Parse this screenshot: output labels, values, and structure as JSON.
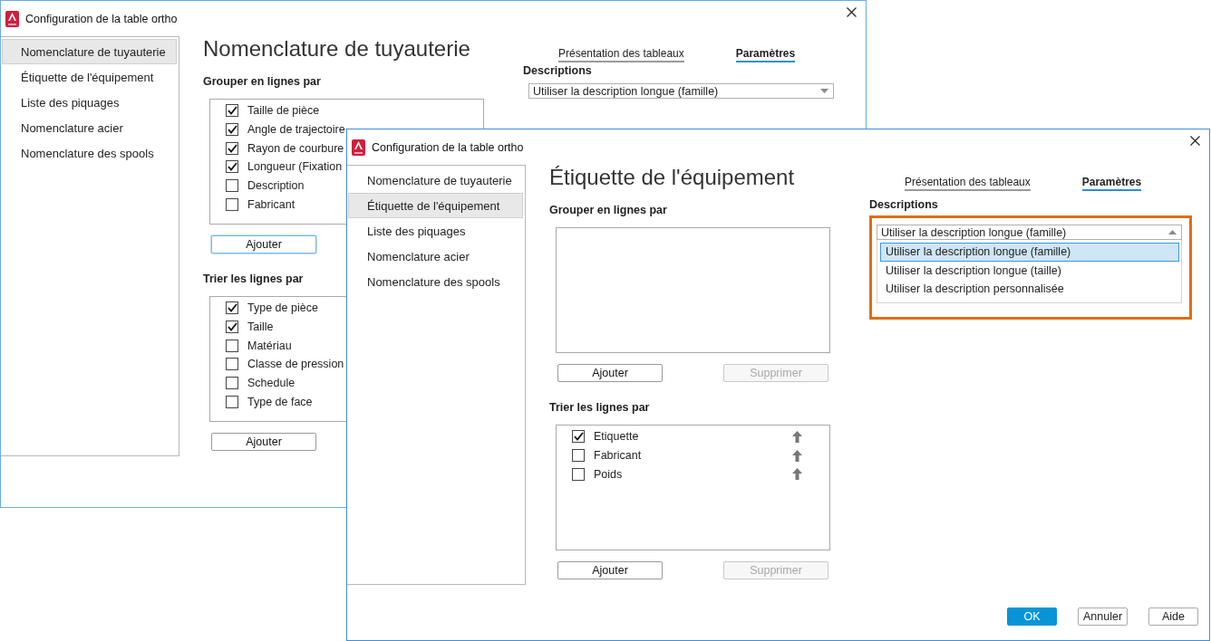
{
  "back_window": {
    "title": "Configuration de la table ortho",
    "sidebar": [
      {
        "label": "Nomenclature de tuyauterie",
        "selected": true
      },
      {
        "label": "Étiquette de l'équipement",
        "selected": false
      },
      {
        "label": "Liste des piquages",
        "selected": false
      },
      {
        "label": "Nomenclature acier",
        "selected": false
      },
      {
        "label": "Nomenclature des spools",
        "selected": false
      }
    ],
    "heading": "Nomenclature de tuyauterie",
    "tabs": [
      {
        "label": "Présentation des tableaux",
        "selected": false
      },
      {
        "label": "Paramètres",
        "selected": true
      }
    ],
    "group": {
      "label": "Grouper en lignes par",
      "items": [
        {
          "label": "Taille de pièce",
          "checked": true
        },
        {
          "label": "Angle de trajectoire",
          "checked": true
        },
        {
          "label": "Rayon de courbure",
          "checked": true
        },
        {
          "label": "Longueur (Fixation",
          "checked": true
        },
        {
          "label": "Description",
          "checked": false
        },
        {
          "label": "Fabricant",
          "checked": false
        }
      ],
      "buttons": [
        {
          "label": "Ajouter",
          "disabled": false,
          "focused": true
        }
      ]
    },
    "sort": {
      "label": "Trier les lignes par",
      "items": [
        {
          "label": "Type de pièce",
          "checked": true
        },
        {
          "label": "Taille",
          "checked": true
        },
        {
          "label": "Matériau",
          "checked": false
        },
        {
          "label": "Classe de pression",
          "checked": false
        },
        {
          "label": "Schedule",
          "checked": false
        },
        {
          "label": "Type de face",
          "checked": false
        }
      ],
      "buttons": [
        {
          "label": "Ajouter",
          "disabled": false,
          "focused": false
        }
      ]
    },
    "descriptions": {
      "label": "Descriptions",
      "value": "Utiliser la description longue (famille)",
      "open": false
    }
  },
  "front_window": {
    "title": "Configuration de la table ortho",
    "sidebar": [
      {
        "label": "Nomenclature de tuyauterie",
        "selected": false
      },
      {
        "label": "Étiquette de l'équipement",
        "selected": true
      },
      {
        "label": "Liste des piquages",
        "selected": false
      },
      {
        "label": "Nomenclature acier",
        "selected": false
      },
      {
        "label": "Nomenclature des spools",
        "selected": false
      }
    ],
    "heading": "Étiquette de l'équipement",
    "tabs": [
      {
        "label": "Présentation des tableaux",
        "selected": false
      },
      {
        "label": "Paramètres",
        "selected": true
      }
    ],
    "group": {
      "label": "Grouper en lignes par",
      "buttons": [
        {
          "label": "Ajouter",
          "disabled": false,
          "focused": false
        },
        {
          "label": "Supprimer",
          "disabled": true,
          "focused": false
        }
      ]
    },
    "sort": {
      "label": "Trier les lignes par",
      "items": [
        {
          "label": "Etiquette",
          "checked": true
        },
        {
          "label": "Fabricant",
          "checked": false
        },
        {
          "label": "Poids",
          "checked": false
        }
      ],
      "buttons": [
        {
          "label": "Ajouter",
          "disabled": false,
          "focused": false
        },
        {
          "label": "Supprimer",
          "disabled": true,
          "focused": false
        }
      ]
    },
    "descriptions": {
      "label": "Descriptions",
      "value": "Utiliser la description longue (famille)",
      "open": true,
      "highlighted": true,
      "options": [
        {
          "label": "Utiliser la description longue (famille)",
          "selected": true
        },
        {
          "label": "Utiliser la description longue (taille)",
          "selected": false
        },
        {
          "label": "Utiliser la description personnalisée",
          "selected": false
        }
      ]
    },
    "footer": [
      {
        "label": "OK",
        "kind": "primary"
      },
      {
        "label": "Annuler",
        "kind": "secondary"
      },
      {
        "label": "Aide",
        "kind": "secondary"
      }
    ]
  }
}
